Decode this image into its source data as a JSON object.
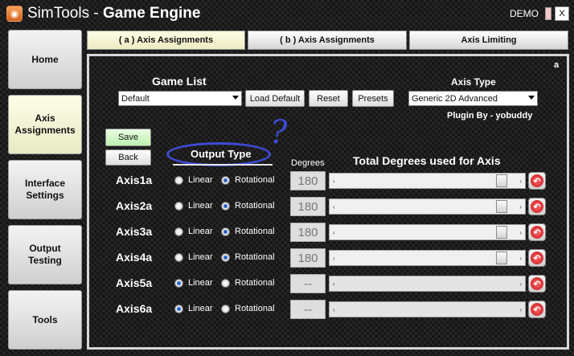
{
  "window": {
    "title_part1": "SimTools - ",
    "title_part2": "Game Engine",
    "demo_label": "DEMO",
    "close_glyph": "X",
    "logo_glyph": "◉"
  },
  "sidebar": {
    "items": [
      {
        "label": "Home"
      },
      {
        "label": "Axis\nAssignments",
        "active": true
      },
      {
        "label": "Interface\nSettings"
      },
      {
        "label": "Output\nTesting"
      },
      {
        "label": "Tools"
      }
    ]
  },
  "tabs": [
    {
      "label": "( a ) Axis Assignments",
      "active": true
    },
    {
      "label": "( b ) Axis Assignments"
    },
    {
      "label": "Axis Limiting"
    }
  ],
  "panel": {
    "letter": "a",
    "game_list_label": "Game List",
    "game_list_value": "Default",
    "axis_type_label": "Axis Type",
    "axis_type_value": "Generic 2D Advanced",
    "plugin_by": "Plugin By - yobuddy",
    "load_default": "Load Default",
    "reset": "Reset",
    "presets": "Presets",
    "save": "Save",
    "back": "Back",
    "output_type_label": "Output Type",
    "question_mark": "?",
    "degrees_label": "Degrees",
    "total_degrees_label": "Total Degrees used for Axis",
    "linear_label": "Linear",
    "rotational_label": "Rotational",
    "slider_left_glyph": "‹",
    "slider_right_glyph": "›",
    "reset_glyph": "↶"
  },
  "axes": [
    {
      "name": "Axis1a",
      "output": "rotational",
      "degrees": "180",
      "slider_fraction": 0.96
    },
    {
      "name": "Axis2a",
      "output": "rotational",
      "degrees": "180",
      "slider_fraction": 0.96
    },
    {
      "name": "Axis3a",
      "output": "rotational",
      "degrees": "180",
      "slider_fraction": 0.96
    },
    {
      "name": "Axis4a",
      "output": "rotational",
      "degrees": "180",
      "slider_fraction": 0.96
    },
    {
      "name": "Axis5a",
      "output": "linear",
      "degrees": "--",
      "slider_fraction": null
    },
    {
      "name": "Axis6a",
      "output": "linear",
      "degrees": "--",
      "slider_fraction": null
    }
  ],
  "colors": {
    "annotation_blue": "#3d4bd6",
    "active_tab": "#fdfde4",
    "save_green": "#bff0b0",
    "reset_red": "#c4121a"
  }
}
